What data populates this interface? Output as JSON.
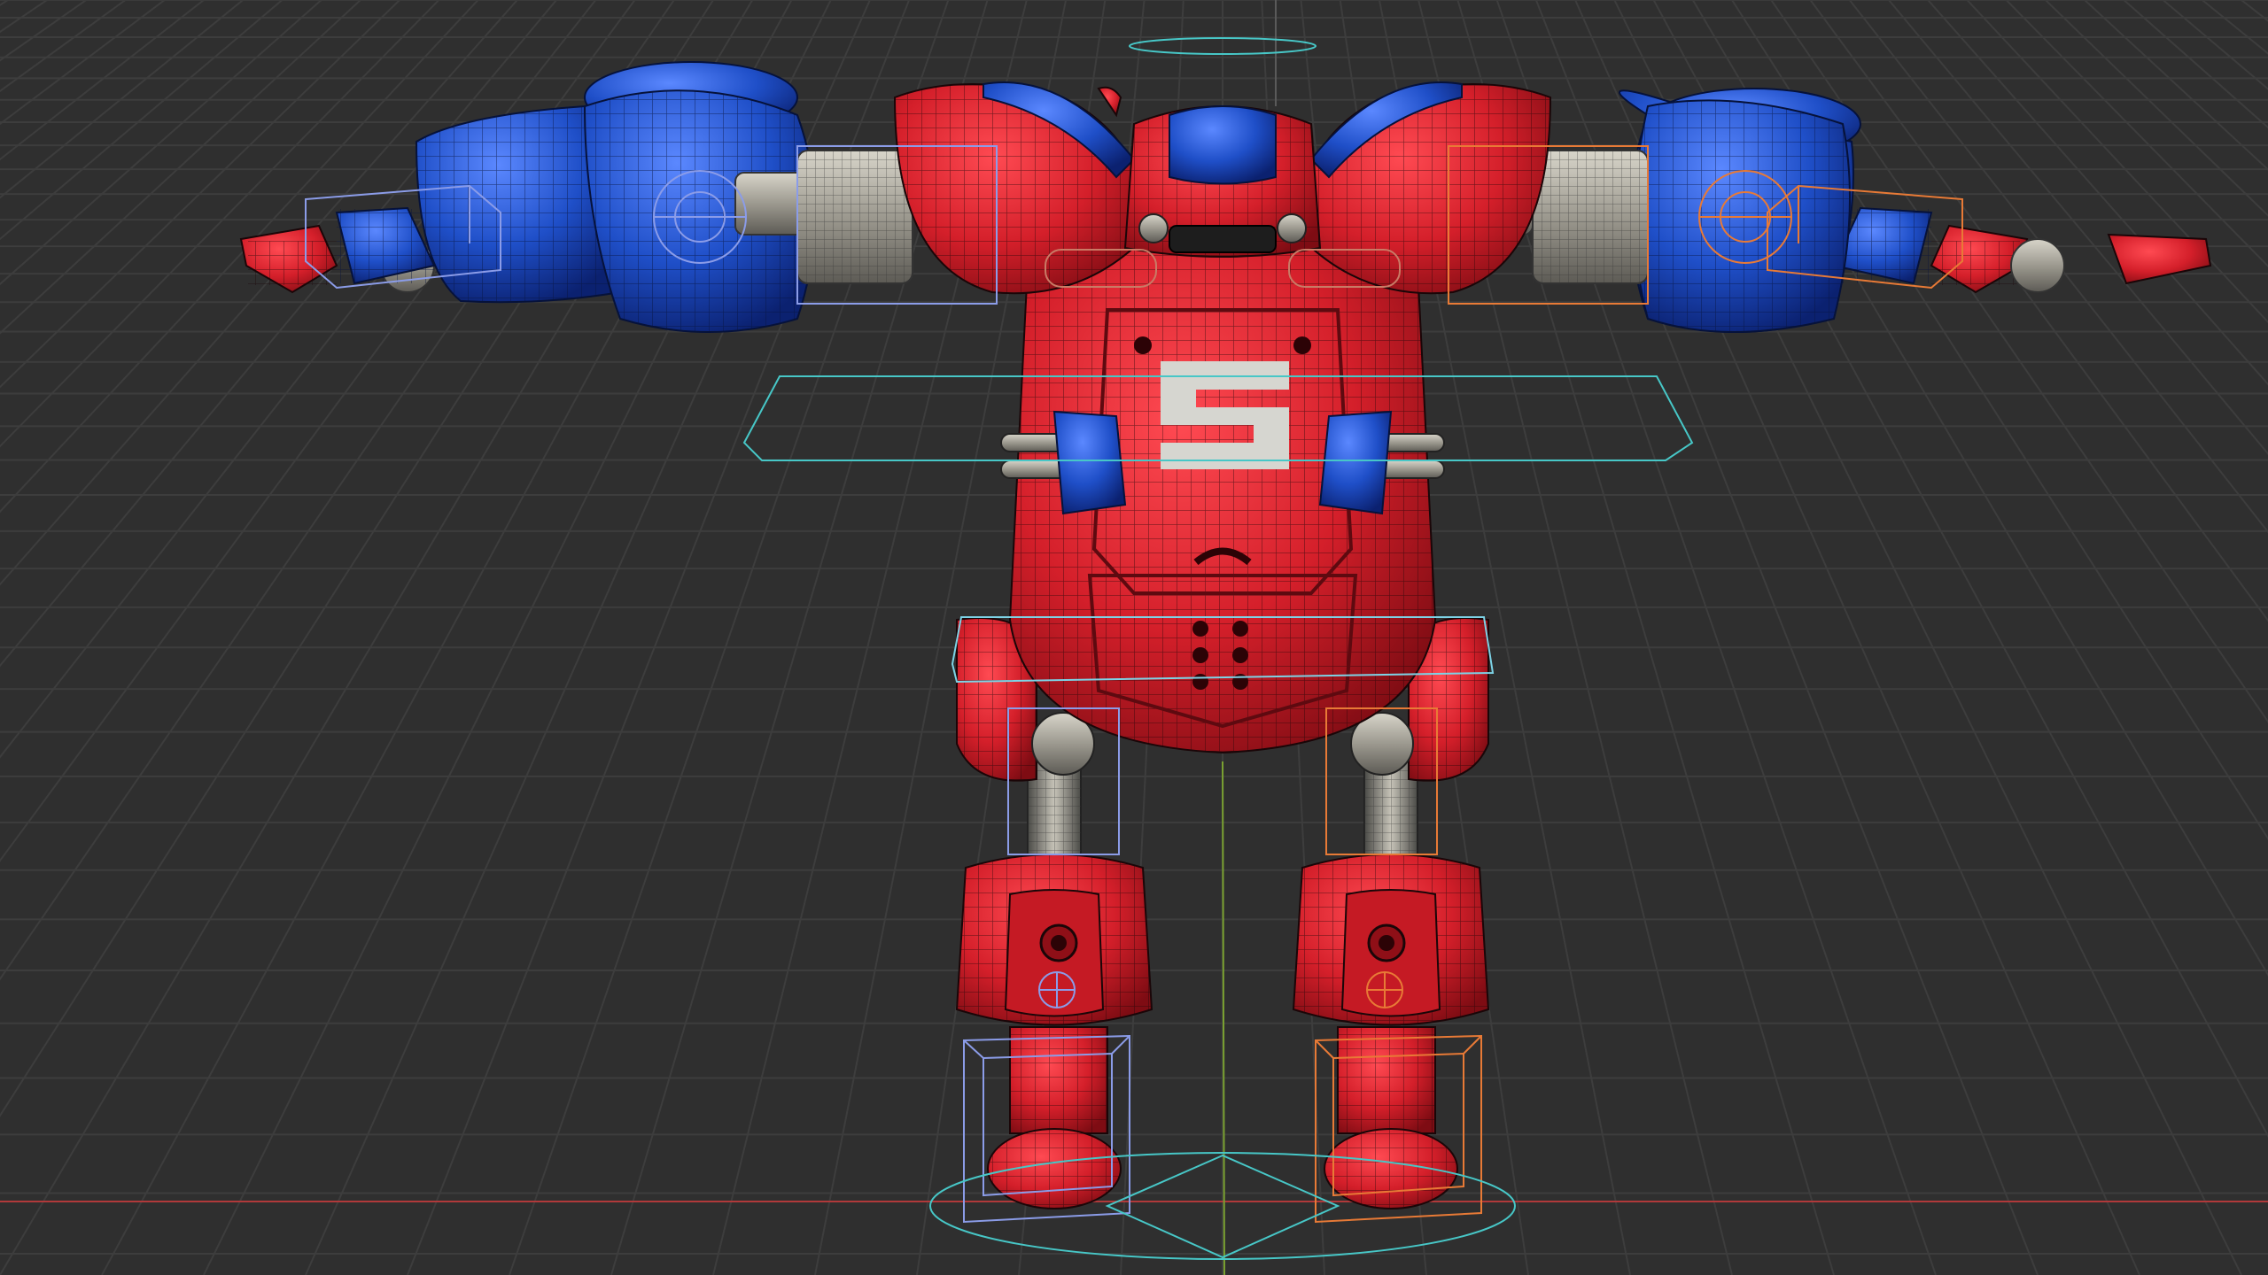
{
  "app": {
    "mode": "3d-viewport"
  },
  "viewport": {
    "background": "#2f2f2f",
    "grid": true,
    "grid_line_color": "#3d3d3d",
    "grid_line_color_minor": "#373737",
    "x_axis_color": "#b0393a",
    "y_axis_color": "#7aa131",
    "shading": "solid-with-wireframe-overlay"
  },
  "character": {
    "name": "",
    "logo_glyph": "S",
    "body_color": "#d41f2a",
    "body_shade_color": "#8f0f17",
    "armor_accent_color": "#1f4fc8",
    "armor_accent_shade_color": "#0f2e86",
    "metal_color": "#b9b6aa",
    "joint_color": "#6a6a62",
    "wire_color": "#200a0a",
    "logo_color": "#d6d6d0"
  },
  "rig": {
    "root_control_color": "#47c7c7",
    "center_control_color": "#7dd3e6",
    "left_control_color": "#8b9ce8",
    "right_control_color": "#e87a36",
    "controls": [
      {
        "name": "root-control",
        "side": "center"
      },
      {
        "name": "hip-control",
        "side": "center"
      },
      {
        "name": "chest-control",
        "side": "center"
      },
      {
        "name": "head-control",
        "side": "center"
      },
      {
        "name": "arm-ik-control",
        "side": "left"
      },
      {
        "name": "arm-ik-control",
        "side": "right"
      },
      {
        "name": "hand-control",
        "side": "left"
      },
      {
        "name": "hand-control",
        "side": "right"
      },
      {
        "name": "thigh-control",
        "side": "left"
      },
      {
        "name": "thigh-control",
        "side": "right"
      },
      {
        "name": "foot-ik-control",
        "side": "left"
      },
      {
        "name": "foot-ik-control",
        "side": "right"
      }
    ]
  }
}
